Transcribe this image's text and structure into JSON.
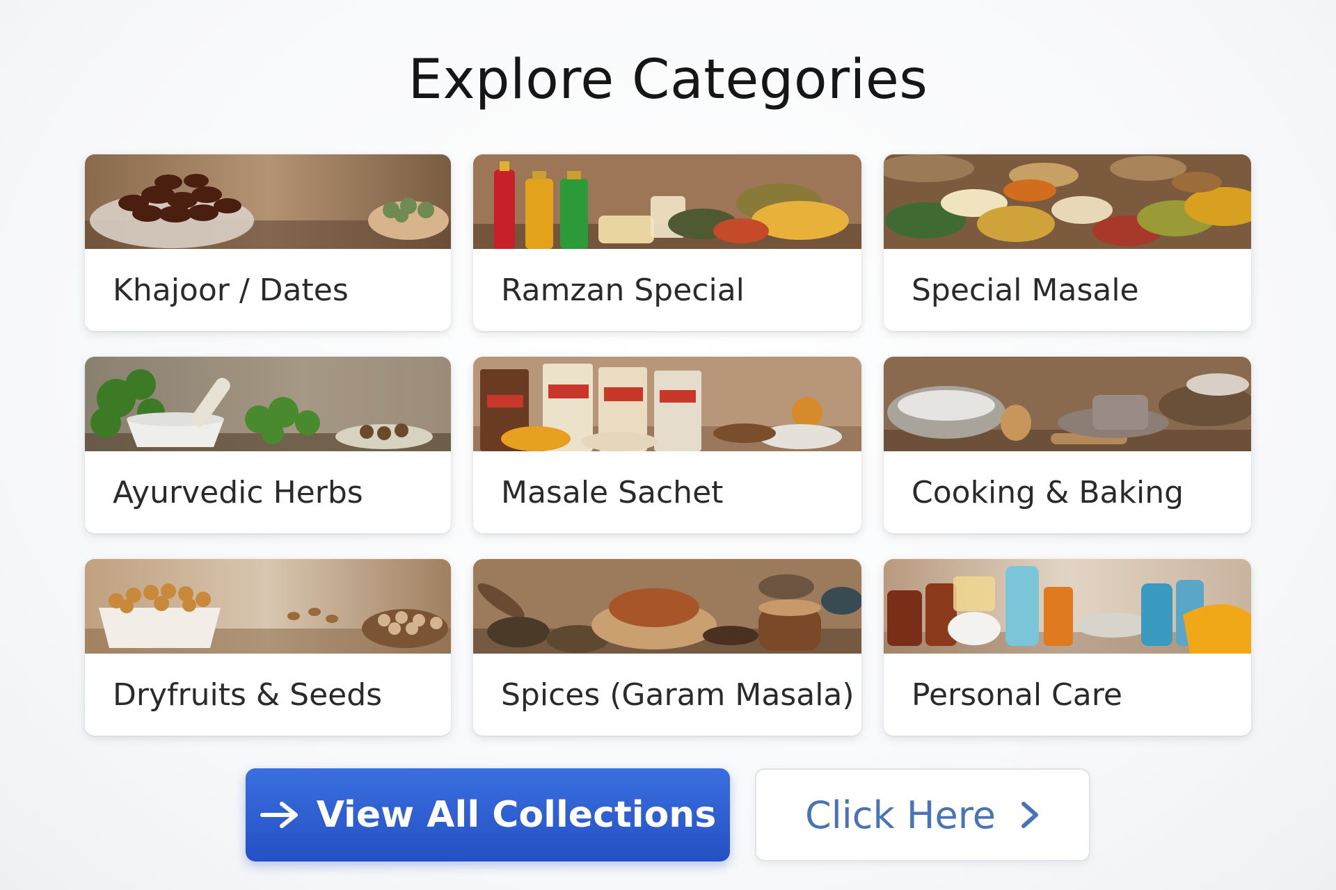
{
  "page": {
    "title": "Explore Categories"
  },
  "categories": [
    {
      "label": "Khajoor / Dates",
      "icon": "dates-image"
    },
    {
      "label": "Ramzan Special",
      "icon": "ramzan-image"
    },
    {
      "label": "Special Masale",
      "icon": "masale-image"
    },
    {
      "label": "Ayurvedic Herbs",
      "icon": "herbs-image"
    },
    {
      "label": "Masale Sachet",
      "icon": "sachet-image"
    },
    {
      "label": "Cooking & Baking",
      "icon": "baking-image"
    },
    {
      "label": "Dryfruits & Seeds",
      "icon": "dryfruits-image"
    },
    {
      "label": "Spices (Garam Masala)",
      "icon": "spices-image"
    },
    {
      "label": "Personal Care",
      "icon": "personal-care-image"
    }
  ],
  "actions": {
    "view_all_label": "View All Collections",
    "click_here_label": "Click Here"
  },
  "colors": {
    "primary": "#2f5fd6",
    "secondary_text": "#4a72b8"
  }
}
